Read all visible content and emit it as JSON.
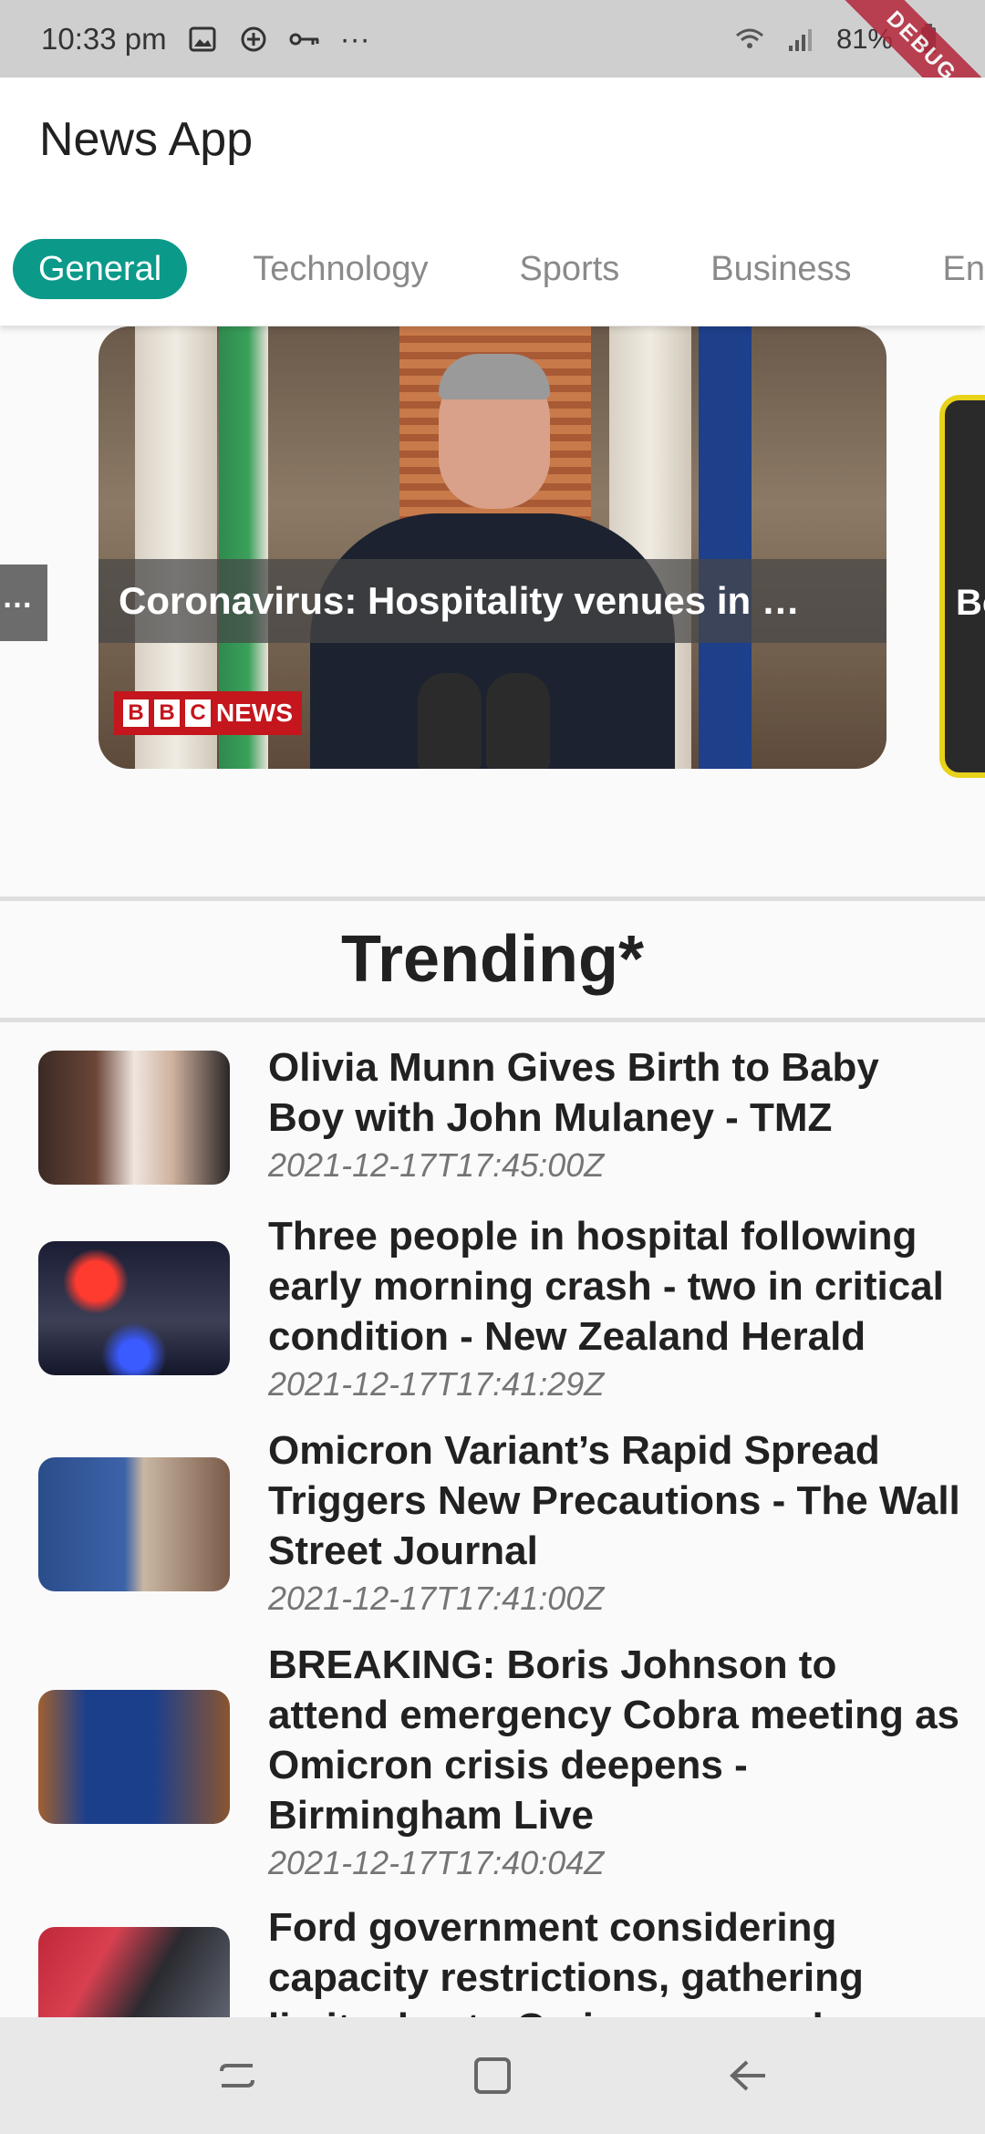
{
  "status_bar": {
    "time": "10:33 pm",
    "more": "···",
    "battery": "81%",
    "debug_label": "DEBUG"
  },
  "app": {
    "title": "News App",
    "tabs": [
      {
        "label": "General",
        "active": true
      },
      {
        "label": "Technology",
        "active": false
      },
      {
        "label": "Sports",
        "active": false
      },
      {
        "label": "Business",
        "active": false
      },
      {
        "label": "Ente",
        "active": false
      }
    ]
  },
  "carousel": {
    "main_title": "Coronavirus: Hospitality venues in …",
    "source_logo": {
      "letters": [
        "B",
        "B",
        "C"
      ],
      "word": "NEWS"
    },
    "left_peek_text": "…",
    "right_peek_text": "Bo"
  },
  "trending": {
    "heading": "Trending*",
    "items": [
      {
        "title": "Olivia Munn Gives Birth to Baby Boy with John Mulaney - TMZ",
        "date": "2021-12-17T17:45:00Z"
      },
      {
        "title": "Three people in hospital following early morning crash - two in critical condition - New Zealand Herald",
        "date": "2021-12-17T17:41:29Z"
      },
      {
        "title": "Omicron Variant’s Rapid Spread Triggers New Precautions - The Wall Street Journal",
        "date": "2021-12-17T17:41:00Z"
      },
      {
        "title": "BREAKING: Boris Johnson to attend emergency Cobra meeting as Omicron crisis deepens - Birmingham Live",
        "date": "2021-12-17T17:40:04Z"
      },
      {
        "title": "Ford government considering capacity restrictions, gathering limits due to Omicron spread",
        "date": ""
      }
    ]
  },
  "colors": {
    "accent": "#0b9a8a",
    "status_bar": "#cfcfcf",
    "nav_bar": "#e8e8e8",
    "debug": "#b3263a"
  }
}
